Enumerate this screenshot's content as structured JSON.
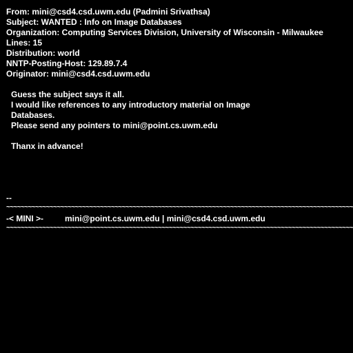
{
  "header": {
    "from": "From: mini@csd4.csd.uwm.edu (Padmini Srivathsa)",
    "subject": "Subject: WANTED : Info on Image Databases",
    "organization": "Organization: Computing Services Division, University of Wisconsin - Milwaukee",
    "lines": "Lines: 15",
    "distribution": "Distribution: world",
    "nntp_host": "NNTP-Posting-Host: 129.89.7.4",
    "originator": "Originator: mini@csd4.csd.uwm.edu"
  },
  "body": {
    "line1": "Guess the subject says it all.",
    "line2": "I would like references to any introductory material on Image",
    "line3": "Databases.",
    "line4": "Please send any pointers to mini@point.cs.uwm.edu",
    "line5": "Thanx in advance!"
  },
  "signature": {
    "dashes": "--",
    "rule": "~~~~~~~~~~~~~~~~~~~~~~~~~~~~~~~~~~~~~~~~~~~~~~~~~~~~~~~~~~~~~~~~~~~~~~~~~~~~~~~~~~~~~~~~~~~~~~~~~~~~~~~~~~~~~~~~",
    "name": "-< MINI >-",
    "emails": "mini@point.cs.uwm.edu | mini@csd4.csd.uwm.edu"
  }
}
